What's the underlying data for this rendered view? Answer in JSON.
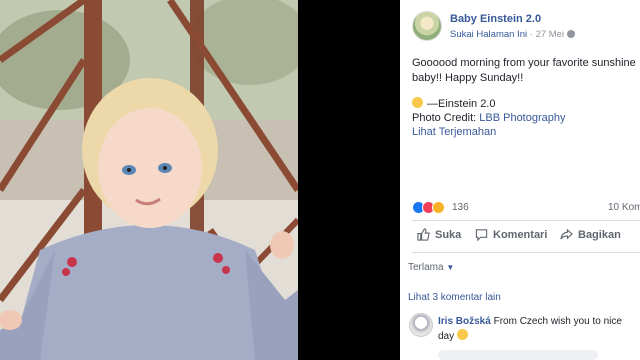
{
  "post": {
    "page_name": "Baby Einstein 2.0",
    "like_page": "Sukai Halaman Ini",
    "separator": " · ",
    "date": "27 Mei",
    "text": "Goooood morning from your favorite sunshine baby!! Happy Sunday!!",
    "signature": "—Einstein 2.0",
    "credit_label": "Photo Credit: ",
    "credit_link": "LBB Photography",
    "translate": "Lihat Terjemahan"
  },
  "stats": {
    "reaction_count": "136",
    "comment_count": "10 Kom"
  },
  "actions": {
    "like": "Suka",
    "comment": "Komentari",
    "share": "Bagikan"
  },
  "comments": {
    "sort": "Terlama",
    "more": "Lihat 3 komentar lain",
    "items": [
      {
        "author": "Iris Božská",
        "text": " From Czech wish you to nice day "
      }
    ]
  },
  "colors": {
    "link": "#385898",
    "like": "#1877f2",
    "love": "#f33e58",
    "wow": "#f7b125"
  },
  "icons": [
    "globe-icon",
    "smiley-emoji",
    "like-icon",
    "comment-icon",
    "share-icon"
  ]
}
